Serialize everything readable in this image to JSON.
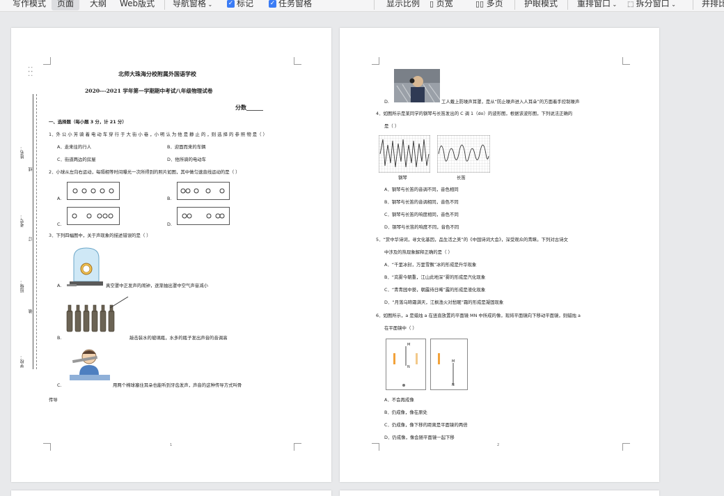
{
  "toolbar": {
    "write_mode": "写作模式",
    "page_view": "页面",
    "outline": "大纲",
    "web_layout": "Web版式",
    "nav_pane": "导航窗格",
    "mark": "标记",
    "task_pane": "任务窗格",
    "zoom": "显示比例",
    "single_page": "页宽",
    "multi_page": "多页",
    "eye_mode": "护眼模式",
    "arrange": "重排窗口",
    "split": "拆分窗口",
    "side_by_side": "并排比"
  },
  "page1": {
    "school": "北师大珠海分校附属外国语学校",
    "exam_title": "2020---2021 学年第一学期期中考试八年级物理试卷",
    "score": "分数______",
    "section1": "一、选择题（每小题 3 分，计 21 分）",
    "q1": "1．外 公 小 芳 骑 着 电 动 车 穿 行 于 大 街 小 巷 ，小 明 认 为 他 是 静 止 的 ，则 选 择 的 参 照 物 是（      ）",
    "q1_a": "A．走来往的行人",
    "q1_b": "B．迎面而来的车辆",
    "q1_c": "C．街道两边的房屋",
    "q1_d": "D．他所骑的电动车",
    "q2": "2．小球从左向右运动，每隔相等时间曝光一次所得到的照片如图，其中做匀速直线运动的是（      ）",
    "q2_a": "A.",
    "q2_b": "B.",
    "q2_c": "C.",
    "q2_d": "D.",
    "q3": "3．下列四幅图中，关于声现象的描述错误的是（      ）",
    "q3_a_label": "A.",
    "q3_a": "真空罩中正发声的闹钟，逐渐抽出罩中空气声音减小",
    "q3_b_label": "B.",
    "q3_b": "敲击装水的玻璃瓶，水多的瓶子发出声音的音调高",
    "q3_c_label": "C.",
    "q3_c": "用两个棉球塞住耳朵也能听到牙齿发声，声音的这种传导方式叫骨",
    "q3_c_cont": "传导",
    "side_name": "姓名：",
    "side_line": "线",
    "side_id": "考号：",
    "side_ding": "订",
    "side_class": "班级：",
    "side_zhuang": "装",
    "side_school": "学校：",
    "page_no": "1"
  },
  "page2": {
    "q3_d_label": "D.",
    "q3_d": "工人戴上防噪声耳罩，是从“防止噪声进入人耳朵”的方面着手控制噪声",
    "q4": "4．如图所示是某同学的钢琴与长笛发出的 C 调 1（do）的波形图，根据该波形图，下列说法正确的",
    "q4_cont": "是（      ）",
    "piano": "钢琴",
    "flute": "长笛",
    "q4_a": "A．钢琴与长笛的音调不同，音色相同",
    "q4_b": "B．钢琴与长笛的音调相同，音色不同",
    "q4_c": "C．钢琴与长笛的响度相同，音色不同",
    "q4_d": "D．钢琴与长笛的响度不同，音色不同",
    "q5": "5．“赏中华诗词，寻文化基因，品生活之美”的《中国诗词大会》，深受观众的青睐。下列对古诗文",
    "q5_cont": "中涉及的热现象解释正确的是（      ）",
    "q5_a": "A．“千里冰封，万里雪飘”冰的形成是升华现象",
    "q5_b": "B．“岚雾今朝重，江山此地深”雾的形成是汽化现象",
    "q5_c": "C．“青青园中葵，朝露待日晞”露的形成是液化现象",
    "q5_d": "D．“月落乌啼霜满天，江枫渔火对愁眠”霜的形成是凝固现象",
    "q6": "6．如图所示，a 是蜡烛 a 在竖直放置的平面镜 MN 中所成的像，现将平面镜向下移动平面镜，则蜡烛 a",
    "q6_cont": "在平面镜中（      ）",
    "fig_m": "M",
    "fig_n": "N",
    "fig_m2": "M",
    "fig_n2": "N",
    "q6_a": "A．不会再成像",
    "q6_b": "B．仍成像，像在原处",
    "q6_c": "C．仍成像，像下移的距离是平面镜的两倍",
    "q6_d": "D．仍成像，像会随平面镜一起下移",
    "page_no": "2"
  }
}
